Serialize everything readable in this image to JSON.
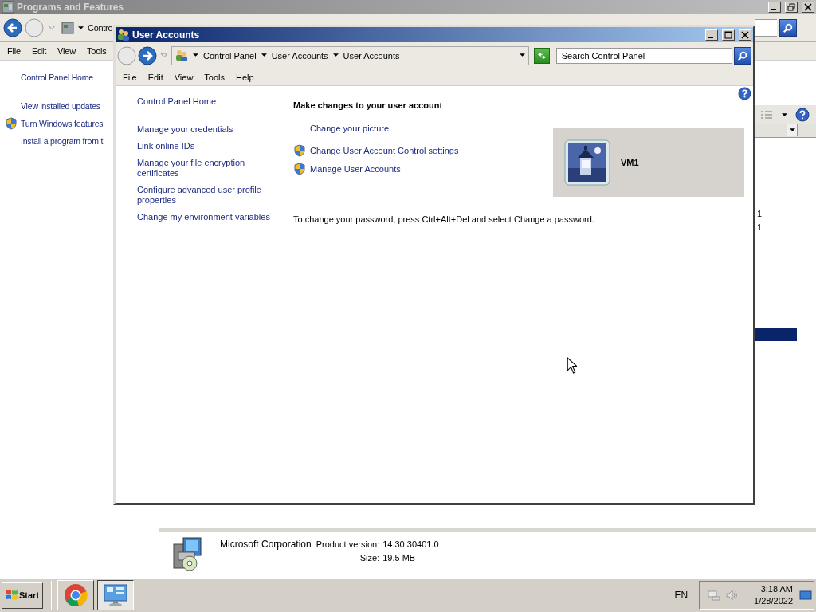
{
  "background_window": {
    "title": "Programs and Features",
    "breadcrumb": "Contro",
    "menu": [
      "File",
      "Edit",
      "View",
      "Tools"
    ],
    "sidebar_links": [
      {
        "label": "Control Panel Home",
        "shield": false
      },
      {
        "label": "View installed updates",
        "shield": false
      },
      {
        "label": "Turn Windows features",
        "shield": true
      },
      {
        "label": "Install a program from t",
        "shield": false
      }
    ],
    "rows": [
      {
        "cell": "1",
        "selected": false
      },
      {
        "cell": "1",
        "selected": false
      },
      {
        "selected": true
      }
    ],
    "details": {
      "publisher": "Microsoft Corporation",
      "fields": [
        {
          "label": "Product version:",
          "value": "14.30.30401.0"
        },
        {
          "label": "Size:",
          "value": "19.5 MB"
        }
      ]
    }
  },
  "user_accounts_window": {
    "title": "User Accounts",
    "breadcrumb": [
      "Control Panel",
      "User Accounts",
      "User Accounts"
    ],
    "search": {
      "placeholder": "Search Control Panel"
    },
    "menu": [
      "File",
      "Edit",
      "View",
      "Tools",
      "Help"
    ],
    "sidebar": {
      "home": "Control Panel Home",
      "links": [
        "Manage your credentials",
        "Link online IDs",
        "Manage your file encryption certificates",
        "Configure advanced user profile properties",
        "Change my environment variables"
      ]
    },
    "heading": "Make changes to your user account",
    "tasks": [
      {
        "label": "Change your picture",
        "shield": false
      },
      {
        "label": "Change User Account Control settings",
        "shield": true
      },
      {
        "label": "Manage User Accounts",
        "shield": true
      }
    ],
    "user": {
      "name": "VM1"
    },
    "note": "To change your password, press Ctrl+Alt+Del and select Change a password."
  },
  "taskbar": {
    "start": "Start",
    "buttons": [
      {
        "kind": "chrome",
        "selected": false
      },
      {
        "kind": "control-panel",
        "selected": true
      }
    ],
    "language": "EN",
    "time": "3:18 AM",
    "date": "1/28/2022"
  }
}
